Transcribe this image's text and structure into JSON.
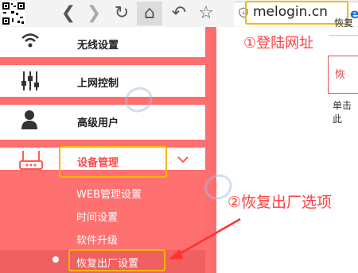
{
  "browser": {
    "url": "melogin.cn",
    "back_glyph": "❮",
    "forward_glyph": "❯",
    "reload_glyph": "↻",
    "home_glyph": "⌂",
    "undo_glyph": "↶",
    "star_glyph": "☆",
    "ext_glyph": "e"
  },
  "sidebar": {
    "items": [
      {
        "label": "无线设置",
        "icon": "wifi-icon"
      },
      {
        "label": "上网控制",
        "icon": "sliders-icon"
      },
      {
        "label": "高级用户",
        "icon": "user-icon"
      },
      {
        "label": "设备管理",
        "icon": "router-icon"
      }
    ],
    "sub_items": [
      {
        "label": "WEB管理设置"
      },
      {
        "label": "时间设置"
      },
      {
        "label": "软件升级"
      },
      {
        "label": "恢复出厂设置"
      }
    ]
  },
  "right_panel": {
    "top_text": "恢复",
    "button_label": "恢",
    "bottom_text": "单击此"
  },
  "annotations": {
    "step1": "①登陆网址",
    "step2": "②恢复出厂选项"
  },
  "colors": {
    "accent": "#ff6e6e",
    "highlight_box": "#f5b800",
    "annotation_red": "#ff4040"
  }
}
